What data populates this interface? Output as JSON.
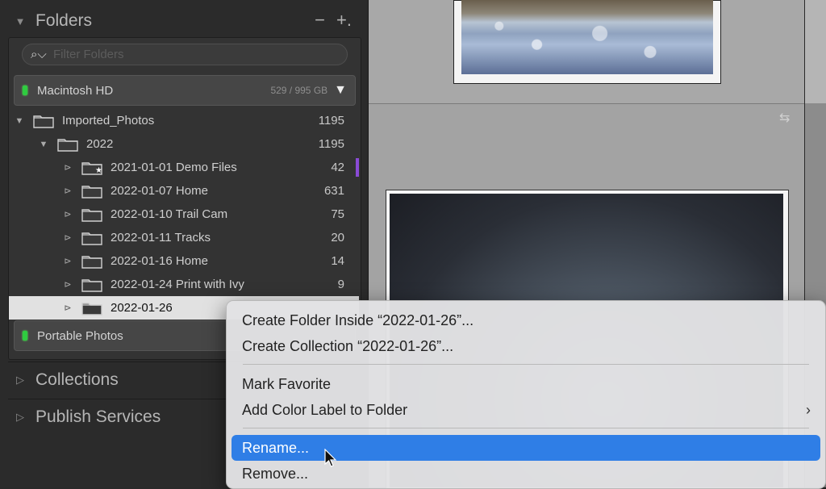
{
  "panel": {
    "folders_title": "Folders",
    "remove_symbol": "−",
    "add_symbol": "+.",
    "search_placeholder": "Filter Folders",
    "collections_title": "Collections",
    "publish_title": "Publish Services"
  },
  "volumes": [
    {
      "name": "Macintosh HD",
      "size": "529 / 995 GB",
      "status_color": "#2fcc40"
    },
    {
      "name": "Portable Photos",
      "status_color": "#2fcc40"
    }
  ],
  "folders": [
    {
      "name": "Imported_Photos",
      "count": "1195",
      "level": 0,
      "expanded": true
    },
    {
      "name": "2022",
      "count": "1195",
      "level": 1,
      "expanded": true
    },
    {
      "name": "2021-01-01 Demo Files",
      "count": "42",
      "level": 2,
      "favorite": true,
      "color_label": "#8a4bd6"
    },
    {
      "name": "2022-01-07 Home",
      "count": "631",
      "level": 2
    },
    {
      "name": "2022-01-10 Trail Cam",
      "count": "75",
      "level": 2
    },
    {
      "name": "2022-01-11 Tracks",
      "count": "20",
      "level": 2
    },
    {
      "name": "2022-01-16 Home",
      "count": "14",
      "level": 2
    },
    {
      "name": "2022-01-24 Print with Ivy",
      "count": "9",
      "level": 2
    },
    {
      "name": "2022-01-26",
      "count": "",
      "level": 2,
      "selected": true
    }
  ],
  "context_menu": {
    "items": [
      "Create Folder Inside “2022-01-26”...",
      "Create Collection “2022-01-26”...",
      "Mark Favorite",
      "Add Color Label to Folder",
      "Rename...",
      "Remove..."
    ],
    "submenu_chevron": "›",
    "highlight_color": "#2f7ee6"
  }
}
